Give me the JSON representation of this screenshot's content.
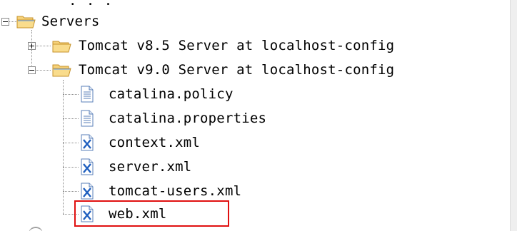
{
  "tree": {
    "top_fragment": "· · ·",
    "root": {
      "label": "Servers",
      "icon": "folder-open-icon",
      "expanded": true
    },
    "servers": [
      {
        "label": "Tomcat v8.5 Server at localhost-config",
        "icon": "folder-icon",
        "expanded": false
      },
      {
        "label": "Tomcat v9.0 Server at localhost-config",
        "icon": "folder-open-icon",
        "expanded": true
      }
    ],
    "files": [
      {
        "label": "catalina.policy",
        "icon": "text-file-icon"
      },
      {
        "label": "catalina.properties",
        "icon": "text-file-icon"
      },
      {
        "label": "context.xml",
        "icon": "xml-file-icon"
      },
      {
        "label": "server.xml",
        "icon": "xml-file-icon"
      },
      {
        "label": "tomcat-users.xml",
        "icon": "xml-file-icon"
      },
      {
        "label": "web.xml",
        "icon": "xml-file-icon",
        "highlighted": true
      }
    ]
  },
  "colors": {
    "highlight_border": "#e01010",
    "folder_fill": "#f6d27a",
    "folder_stroke": "#c6922a",
    "xml_letter": "#1f5fbf"
  }
}
